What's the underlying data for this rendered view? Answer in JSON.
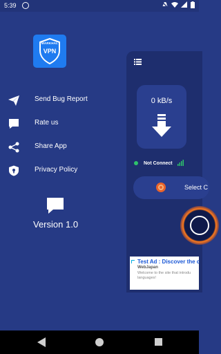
{
  "status_bar": {
    "time": "5:39"
  },
  "drawer": {
    "logo": {
      "top_text": "MARKHAL",
      "main_text": "VPN"
    },
    "menu": [
      {
        "label": "Send Bug Report",
        "icon": "send-icon"
      },
      {
        "label": "Rate us",
        "icon": "chat-bubble-icon"
      },
      {
        "label": "Share App",
        "icon": "share-icon"
      },
      {
        "label": "Privacy Policy",
        "icon": "shield-icon"
      }
    ],
    "version": "Version 1.0"
  },
  "main": {
    "speed": "0  kB/s",
    "connection_status": "Not Connect",
    "select_label": "Select C",
    "status_color": "#2ec36b"
  },
  "ad": {
    "title": "Test Ad : Discover the c",
    "advertiser": "WebJapan",
    "description": "Welcome to the site that introdu languages!"
  },
  "colors": {
    "background": "#263a85",
    "panel": "#1e2e6e",
    "accent": "#1f7bf0",
    "power_ring": "#ff7a1a"
  }
}
